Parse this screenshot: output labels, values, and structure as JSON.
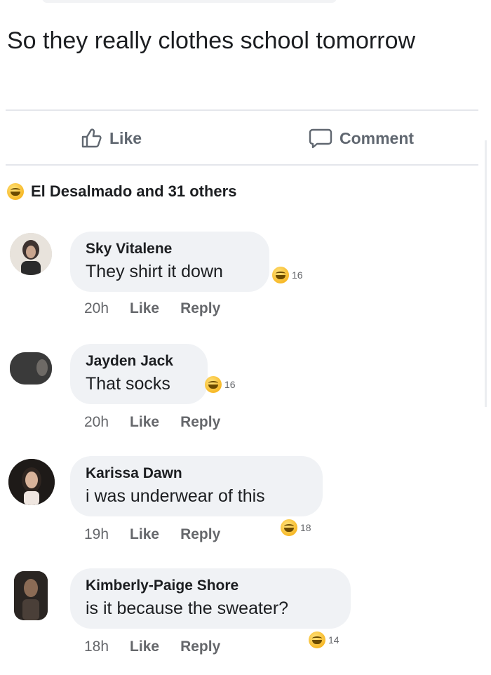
{
  "post": {
    "text": "So they really clothes school tomorrow"
  },
  "actions": {
    "like_label": "Like",
    "comment_label": "Comment"
  },
  "reactions": {
    "summary": "El Desalmado and 31 others"
  },
  "comments": [
    {
      "author": "Sky Vitalene",
      "text": "They shirt it down",
      "reaction_count": "16",
      "time": "20h",
      "like": "Like",
      "reply": "Reply"
    },
    {
      "author": "Jayden Jack",
      "text": "That socks",
      "reaction_count": "16",
      "time": "20h",
      "like": "Like",
      "reply": "Reply"
    },
    {
      "author": "Karissa Dawn",
      "text": "i was underwear of this",
      "reaction_count": "18",
      "time": "19h",
      "like": "Like",
      "reply": "Reply"
    },
    {
      "author": "Kimberly-Paige Shore",
      "text": "is it because the sweater?",
      "reaction_count": "14",
      "time": "18h",
      "like": "Like",
      "reply": "Reply"
    }
  ],
  "colors": {
    "text": "#1c1e21",
    "secondary": "#65676b",
    "bubble": "#f0f2f5",
    "reaction": "#f7b928"
  }
}
